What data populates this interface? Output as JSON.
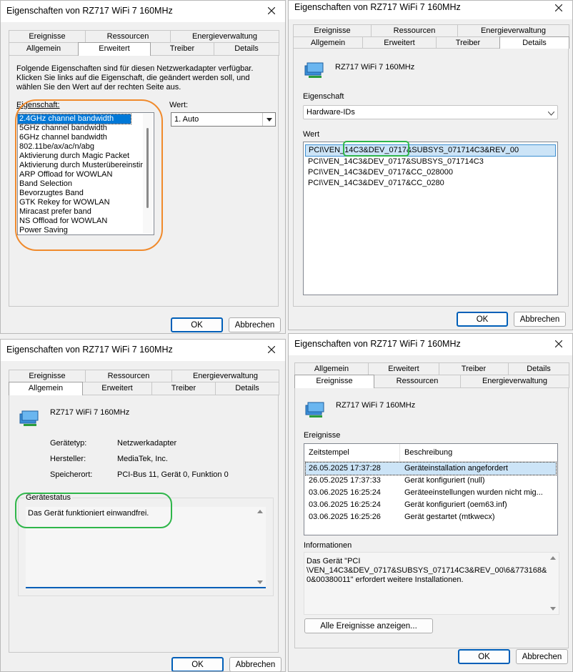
{
  "colors": {
    "accent": "#0078d7",
    "primary_border": "#005fb8",
    "highlight_orange": "#f08a2c",
    "highlight_green": "#2fb64a"
  },
  "device_name": "RZ717 WiFi 7 160MHz",
  "buttons": {
    "ok": "OK",
    "cancel": "Abbrechen"
  },
  "d1": {
    "title": "Eigenschaften von RZ717 WiFi 7 160MHz",
    "tabs_back": [
      "Ereignisse",
      "Ressourcen",
      "Energieverwaltung"
    ],
    "tabs_front": [
      "Allgemein",
      "Erweitert",
      "Treiber",
      "Details"
    ],
    "description": [
      "Folgende Eigenschaften sind für diesen Netzwerkadapter verfügbar.",
      "Klicken Sie links auf die Eigenschaft, die geändert werden soll, und",
      "wählen Sie den Wert auf der rechten Seite aus."
    ],
    "property_label": "Eigenschaft:",
    "value_label": "Wert:",
    "value_selected": "1. Auto",
    "properties": [
      "2.4GHz channel bandwidth",
      "5GHz channel bandwidth",
      "6GHz channel bandwidth",
      "802.11be/ax/ac/n/abg",
      "Aktivierung durch Magic Packet",
      "Aktivierung durch Musterübereinstim",
      "ARP Offload for WOWLAN",
      "Band Selection",
      "Bevorzugtes Band",
      "GTK Rekey for WOWLAN",
      "Miracast prefer band",
      "NS Offload for WOWLAN",
      "Power Saving"
    ]
  },
  "d2": {
    "title": "Eigenschaften von RZ717 WiFi 7 160MHz",
    "tabs_back": [
      "Ereignisse",
      "Ressourcen",
      "Energieverwaltung"
    ],
    "tabs_front": [
      "Allgemein",
      "Erweitert",
      "Treiber",
      "Details"
    ],
    "property_label": "Eigenschaft",
    "property_selected": "Hardware-IDs",
    "value_label": "Wert",
    "values": [
      "PCI\\VEN_14C3&DEV_0717&SUBSYS_071714C3&REV_00",
      "PCI\\VEN_14C3&DEV_0717&SUBSYS_071714C3",
      "PCI\\VEN_14C3&DEV_0717&CC_028000",
      "PCI\\VEN_14C3&DEV_0717&CC_0280"
    ]
  },
  "d3": {
    "title": "Eigenschaften von RZ717 WiFi 7 160MHz",
    "tabs_back": [
      "Ereignisse",
      "Ressourcen",
      "Energieverwaltung"
    ],
    "tabs_front": [
      "Allgemein",
      "Erweitert",
      "Treiber",
      "Details"
    ],
    "fields": [
      {
        "label": "Gerätetyp:",
        "value": "Netzwerkadapter"
      },
      {
        "label": "Hersteller:",
        "value": "MediaTek, Inc."
      },
      {
        "label": "Speicherort:",
        "value": "PCI-Bus 11, Gerät 0, Funktion 0"
      }
    ],
    "status_label": "Gerätestatus",
    "status_text": "Das Gerät funktioniert einwandfrei."
  },
  "d4": {
    "title": "Eigenschaften von RZ717 WiFi 7 160MHz",
    "tabs_back": [
      "Allgemein",
      "Erweitert",
      "Treiber",
      "Details"
    ],
    "tabs_front": [
      "Ereignisse",
      "Ressourcen",
      "Energieverwaltung"
    ],
    "events_label": "Ereignisse",
    "col_time": "Zeitstempel",
    "col_desc": "Beschreibung",
    "events": [
      {
        "time": "26.05.2025 17:37:28",
        "desc": "Geräteinstallation angefordert"
      },
      {
        "time": "26.05.2025 17:37:33",
        "desc": "Gerät konfiguriert (null)"
      },
      {
        "time": "03.06.2025 16:25:24",
        "desc": "Geräteeinstellungen wurden nicht mig..."
      },
      {
        "time": "03.06.2025 16:25:24",
        "desc": "Gerät konfiguriert (oem63.inf)"
      },
      {
        "time": "03.06.2025 16:25:26",
        "desc": "Gerät gestartet (mtkwecx)"
      }
    ],
    "info_label": "Informationen",
    "info_lines": [
      "Das Gerät \"PCI",
      "\\VEN_14C3&DEV_0717&SUBSYS_071714C3&REV_00\\6&773168&",
      "0&00380011\" erfordert weitere Installationen."
    ],
    "show_all_button": "Alle Ereignisse anzeigen..."
  }
}
